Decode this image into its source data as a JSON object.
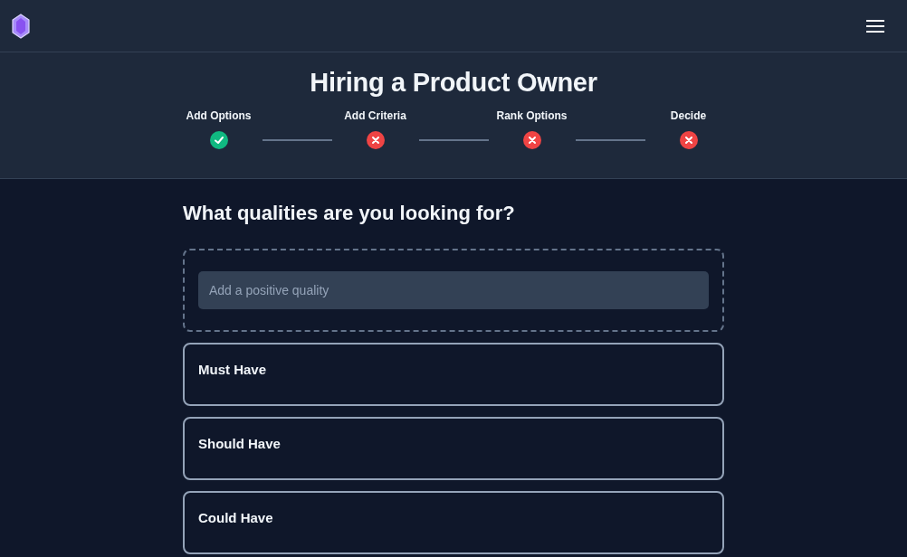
{
  "header": {
    "title": "Hiring a Product Owner"
  },
  "steps": [
    {
      "label": "Add Options",
      "done": true
    },
    {
      "label": "Add Criteria",
      "done": false
    },
    {
      "label": "Rank Options",
      "done": false
    },
    {
      "label": "Decide",
      "done": false
    }
  ],
  "question": "What qualities are you looking for?",
  "quality_input": {
    "placeholder": "Add a positive quality"
  },
  "groups": [
    {
      "title": "Must Have"
    },
    {
      "title": "Should Have"
    },
    {
      "title": "Could Have"
    }
  ]
}
